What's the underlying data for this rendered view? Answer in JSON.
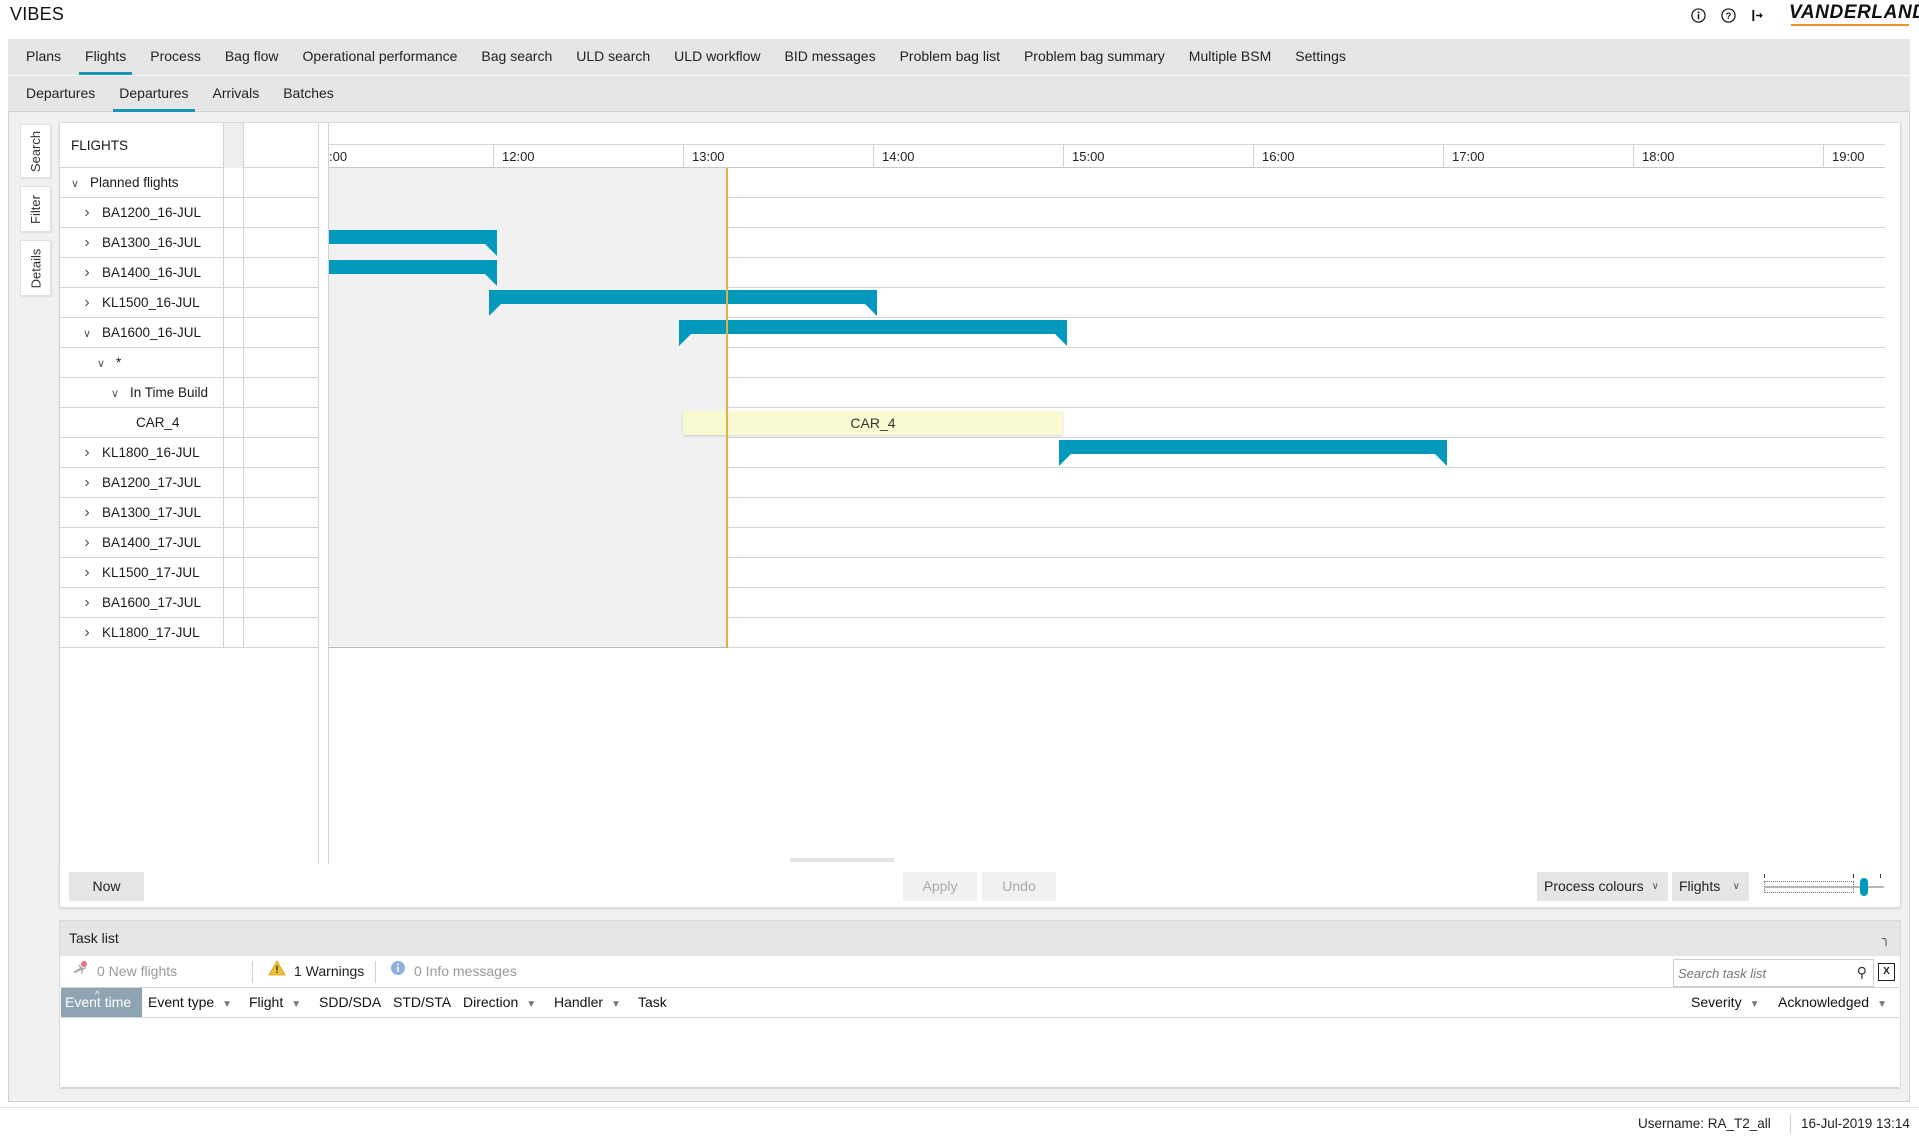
{
  "app": {
    "title": "VIBES",
    "brand": "VANDERLANDE",
    "icons": [
      "info-icon",
      "help-icon",
      "logout-icon"
    ],
    "accent_color": "#0399bc",
    "brand_accent_color": "#e8942c"
  },
  "main_nav": {
    "active": "Flights",
    "items": [
      "Plans",
      "Flights",
      "Process",
      "Bag flow",
      "Operational performance",
      "Bag search",
      "ULD search",
      "ULD workflow",
      "BID messages",
      "Problem bag list",
      "Problem bag summary",
      "Multiple BSM",
      "Settings"
    ]
  },
  "sub_nav": {
    "active_index": 1,
    "items": [
      "Departures",
      "Departures",
      "Arrivals",
      "Batches"
    ]
  },
  "side_tabs": [
    "Search",
    "Filter",
    "Details"
  ],
  "tree": {
    "header": "FLIGHTS",
    "rows": [
      {
        "label": "Planned flights",
        "level": 0,
        "expander": "expanded"
      },
      {
        "label": "BA1200_16-JUL",
        "level": 1,
        "expander": "collapsed"
      },
      {
        "label": "BA1300_16-JUL",
        "level": 1,
        "expander": "collapsed"
      },
      {
        "label": "BA1400_16-JUL",
        "level": 1,
        "expander": "collapsed"
      },
      {
        "label": "KL1500_16-JUL",
        "level": 1,
        "expander": "collapsed"
      },
      {
        "label": "BA1600_16-JUL",
        "level": 1,
        "expander": "expanded"
      },
      {
        "label": "*",
        "level": 2,
        "expander": "expanded"
      },
      {
        "label": "In Time Build",
        "level": 3,
        "expander": "expanded"
      },
      {
        "label": "CAR_4",
        "level": 4,
        "expander": "none"
      },
      {
        "label": "KL1800_16-JUL",
        "level": 1,
        "expander": "collapsed"
      },
      {
        "label": "BA1200_17-JUL",
        "level": 1,
        "expander": "collapsed"
      },
      {
        "label": "BA1300_17-JUL",
        "level": 1,
        "expander": "collapsed"
      },
      {
        "label": "BA1400_17-JUL",
        "level": 1,
        "expander": "collapsed"
      },
      {
        "label": "KL1500_17-JUL",
        "level": 1,
        "expander": "collapsed"
      },
      {
        "label": "BA1600_17-JUL",
        "level": 1,
        "expander": "collapsed"
      },
      {
        "label": "KL1800_17-JUL",
        "level": 1,
        "expander": "collapsed"
      }
    ]
  },
  "timeline": {
    "hours": [
      ":00",
      "12:00",
      "13:00",
      "14:00",
      "15:00",
      "16:00",
      "17:00",
      "18:00",
      "19:00"
    ],
    "visible_start_hour": 11.13,
    "first_full_hour": 12,
    "now_time": "13:14",
    "now_hour": 13.23,
    "bars": [
      {
        "row": 2,
        "label": "BA1300_16-JUL",
        "start_hour": 10.0,
        "end_hour": 12.02,
        "type": "flight"
      },
      {
        "row": 3,
        "label": "BA1400_16-JUL",
        "start_hour": 10.0,
        "end_hour": 12.02,
        "type": "flight"
      },
      {
        "row": 4,
        "label": "KL1500_16-JUL",
        "start_hour": 11.98,
        "end_hour": 14.02,
        "type": "flight"
      },
      {
        "row": 5,
        "label": "BA1600_16-JUL",
        "start_hour": 12.98,
        "end_hour": 15.02,
        "type": "flight"
      },
      {
        "row": 8,
        "label": "CAR_4",
        "start_hour": 13.0,
        "end_hour": 15.0,
        "type": "carrier"
      },
      {
        "row": 9,
        "label": "KL1800_16-JUL",
        "start_hour": 14.98,
        "end_hour": 17.02,
        "type": "flight"
      }
    ]
  },
  "gantt_footer": {
    "now_label": "Now",
    "apply_label": "Apply",
    "undo_label": "Undo",
    "colour_mode": "Process colours",
    "view_mode": "Flights",
    "zoom_slider_value": 0.86
  },
  "task_list": {
    "title": "Task list",
    "new_flights": "0 New flights",
    "warnings": "1 Warnings",
    "info_messages": "0 Info messages",
    "search_placeholder": "Search task list",
    "columns": [
      "Event time",
      "Event type",
      "Flight",
      "SDD/SDA",
      "STD/STA",
      "Direction",
      "Handler",
      "Task",
      "Severity",
      "Acknowledged"
    ],
    "sorted_column": "Event time",
    "rows": []
  },
  "status_bar": {
    "username": "Username: RA_T2_all",
    "datetime": "16-Jul-2019 13:14"
  }
}
